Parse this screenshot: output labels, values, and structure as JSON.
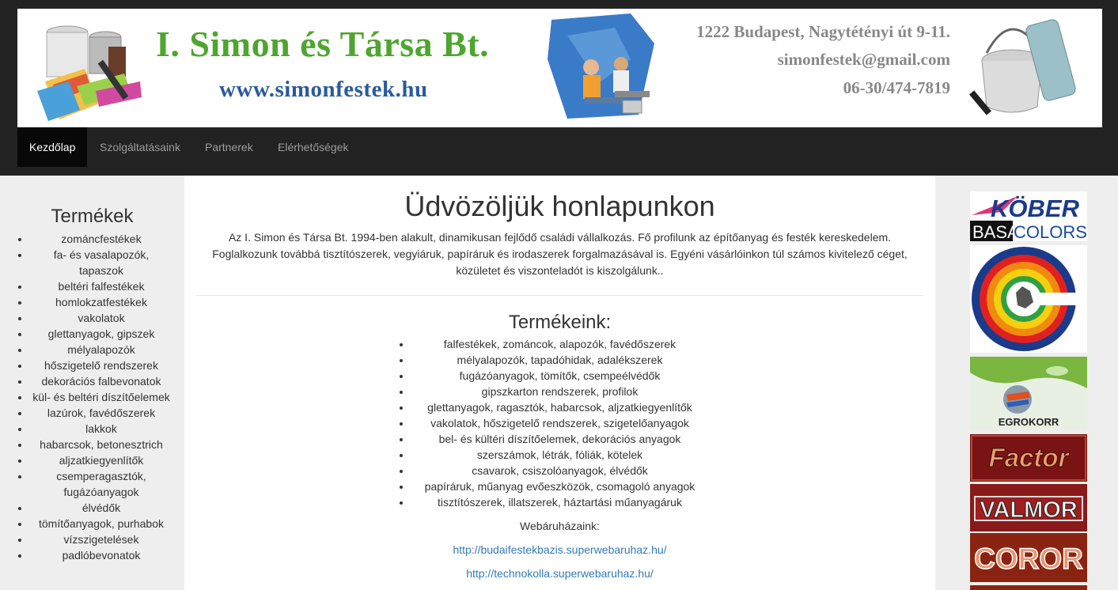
{
  "header": {
    "company": "I. Simon és Társa Bt.",
    "website": "www.simonfestek.hu",
    "address": "1222 Budapest, Nagytétényi út 9-11.",
    "email": "simonfestek@gmail.com",
    "phone": "06-30/474-7819"
  },
  "nav": [
    {
      "label": "Kezdőlap",
      "active": true
    },
    {
      "label": "Szolgáltatásaink"
    },
    {
      "label": "Partnerek"
    },
    {
      "label": "Elérhetőségek"
    }
  ],
  "sidebar": {
    "title": "Termékek",
    "items": [
      "zománcfestékek",
      "fa- és vasalapozók, tapaszok",
      "beltéri falfestékek",
      "homlokzatfestékek",
      "vakolatok",
      "glettanyagok, gipszek",
      "mélyalapozók",
      "hőszigetelő rendszerek",
      "dekorációs falbevonatok",
      "kül- és beltéri díszítőelemek",
      "lazúrok, favédőszerek",
      "lakkok",
      "habarcsok, betonesztrich",
      "aljzatkiegyenlítők",
      "csemperagasztók, fugázóanyagok",
      "élvédők",
      "tömítőanyagok, purhabok",
      "vízszigetelések",
      "padlóbevonatok"
    ]
  },
  "main": {
    "title": "Üdvözöljük honlapunkon",
    "intro": "Az I. Simon és Társa Bt. 1994-ben alakult, dinamikusan fejlődő családi vállalkozás. Fő profilunk az építőanyag és festék kereskedelem. Foglalkozunk továbbá tisztítószerek, vegyiáruk, papíráruk és irodaszerek forgalmazásával is. Egyéni vásárlóinkon túl számos kivitelező céget, közületet és viszonteladót is kiszolgálunk..",
    "products_title": "Termékeink:",
    "products": [
      "falfestékek, zománcok, alapozók, favédőszerek",
      "mélyalapozók, tapadóhidak, adalékszerek",
      "fugázóanyagok, tömítők, csempeélvédők",
      "gipszkarton rendszerek, profilok",
      "glettanyagok, ragasztók, habarcsok, aljzatkiegyenlítők",
      "vakolatok, hőszigetelő rendszerek, szigetelőanyagok",
      "bel- és kültéri díszítőelemek, dekorációs anyagok",
      "szerszámok, létrák, fóliák, kötelek",
      "csavarok, csiszolóanyagok, élvédők",
      "papíráruk, műanyag evőeszközök, csomagoló anyagok",
      "tisztítószerek, illatszerek, háztartási műanyagáruk"
    ],
    "webshops_label": "Webáruházaink:",
    "webshops": [
      "http://budaifestekbazis.superwebaruhaz.hu/",
      "http://technokolla.superwebaruhaz.hu/"
    ]
  },
  "brands": {
    "kober": "KÖBER",
    "basa": "BASA",
    "colors": "COLORS",
    "egrokorr": "EGROKORR",
    "factor": "Factor",
    "valmor": "VALMOR",
    "coror": "COROR"
  }
}
